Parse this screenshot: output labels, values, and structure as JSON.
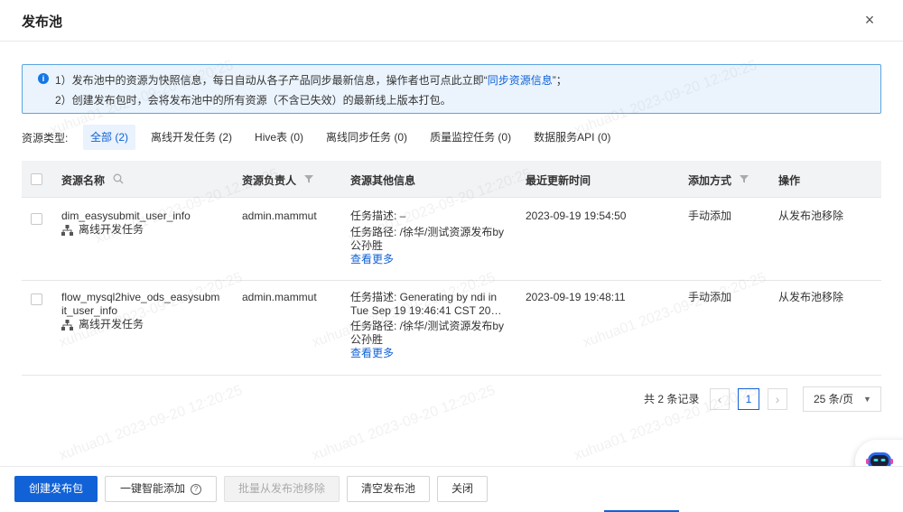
{
  "dialog": {
    "title": "发布池",
    "close_glyph": "×"
  },
  "notice": {
    "line1_prefix": "1）发布池中的资源为快照信息，每日自动从各子产品同步最新信息，操作者也可点此立即“",
    "line1_link": "同步资源信息",
    "line1_suffix": "”；",
    "line2": "2）创建发布包时，会将发布池中的所有资源（不含已失效）的最新线上版本打包。"
  },
  "filter": {
    "label": "资源类型:",
    "tabs": [
      "全部 (2)",
      "离线开发任务 (2)",
      "Hive表 (0)",
      "离线同步任务 (0)",
      "质量监控任务 (0)",
      "数据服务API (0)"
    ]
  },
  "table": {
    "columns": [
      "资源名称",
      "资源负责人",
      "资源其他信息",
      "最近更新时间",
      "添加方式",
      "操作"
    ],
    "rows": [
      {
        "name": "dim_easysubmit_user_info",
        "type": "离线开发任务",
        "owner": "admin.mammut",
        "desc": "任务描述: –",
        "path": "任务路径: /徐华/测试资源发布by公孙胜",
        "more": "查看更多",
        "updated": "2023-09-19 19:54:50",
        "add_method": "手动添加",
        "action": "从发布池移除"
      },
      {
        "name": "flow_mysql2hive_ods_easysubmit_user_info",
        "type": "离线开发任务",
        "owner": "admin.mammut",
        "desc": "任务描述: Generating by ndi in Tue Sep 19 19:46:41 CST 20…",
        "path": "任务路径: /徐华/测试资源发布by公孙胜",
        "more": "查看更多",
        "updated": "2023-09-19 19:48:11",
        "add_method": "手动添加",
        "action": "从发布池移除"
      }
    ]
  },
  "pagination": {
    "total": "共 2 条记录",
    "prev": "‹",
    "next": "›",
    "current": "1",
    "page_size": "25 条/页"
  },
  "footer": {
    "create": "创建发布包",
    "smart_add": "一键智能添加",
    "batch_remove": "批量从发布池移除",
    "clear": "清空发布池",
    "close": "关闭"
  },
  "watermark": "xuhua01 2023-09-20 12:20:25",
  "colors": {
    "primary": "#1162d6",
    "notice_bg": "#ebf4fd",
    "notice_border": "#5ba5e0"
  }
}
